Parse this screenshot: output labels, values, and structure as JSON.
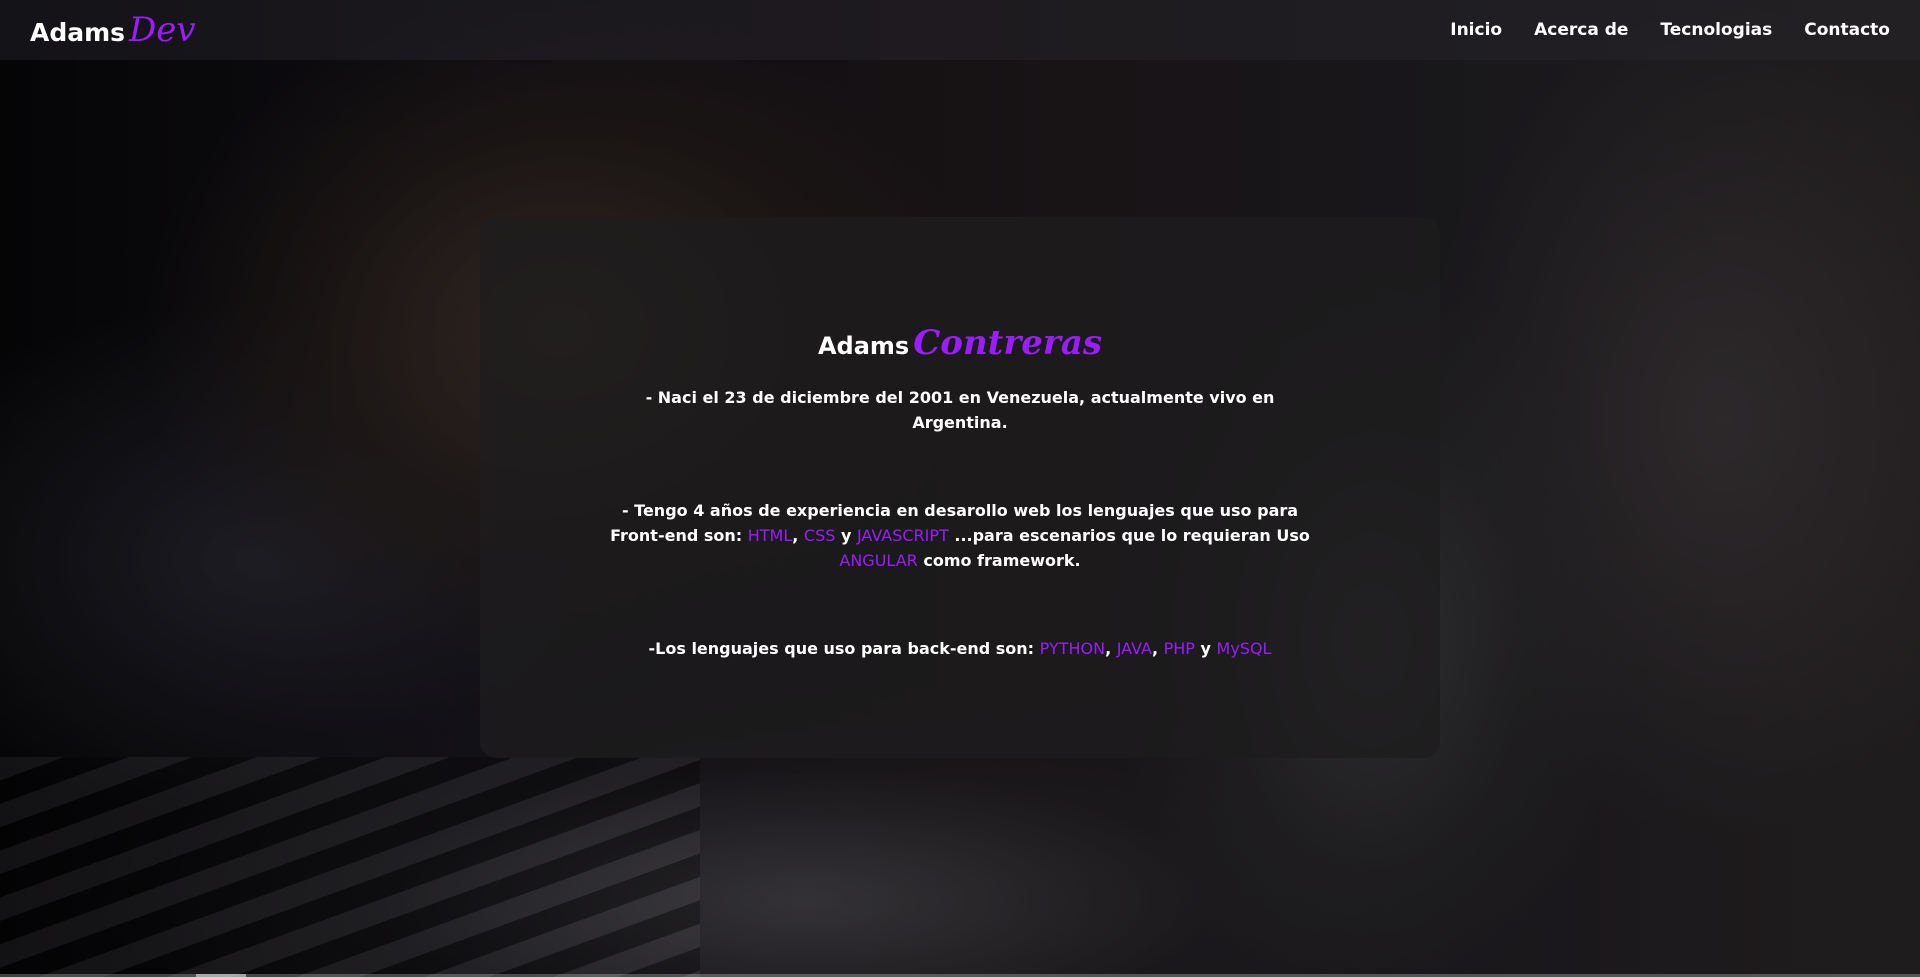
{
  "brand": {
    "main": "Adams",
    "accent": "Dev"
  },
  "nav": {
    "items": [
      {
        "label": "Inicio"
      },
      {
        "label": "Acerca de"
      },
      {
        "label": "Tecnologias"
      },
      {
        "label": "Contacto"
      }
    ]
  },
  "about": {
    "title_main": "Adams",
    "title_accent": "Contreras",
    "p1": "- Naci el 23 de diciembre del 2001 en Venezuela, actualmente vivo en Argentina.",
    "p2": {
      "t1": "- Tengo 4 años de experiencia en desarollo web los lenguajes que uso para Front-end son: ",
      "html": "HTML",
      "sep1": ", ",
      "css": "CSS",
      "sep2": " y ",
      "js": "JAVASCRIPT",
      "t2": " ...para escenarios que lo requieran Uso ",
      "angular": "ANGULAR",
      "t3": " como framework."
    },
    "p3": {
      "t1": "-Los lenguajes que uso para back-end son: ",
      "python": "PYTHON",
      "sep1": ", ",
      "java": "JAVA",
      "sep2": ", ",
      "php": "PHP",
      "sep3": " y ",
      "mysql": "MySQL"
    }
  },
  "colors": {
    "accent": "#9b1dff",
    "text": "#ffffff",
    "card_bg": "#1e1c1e"
  }
}
